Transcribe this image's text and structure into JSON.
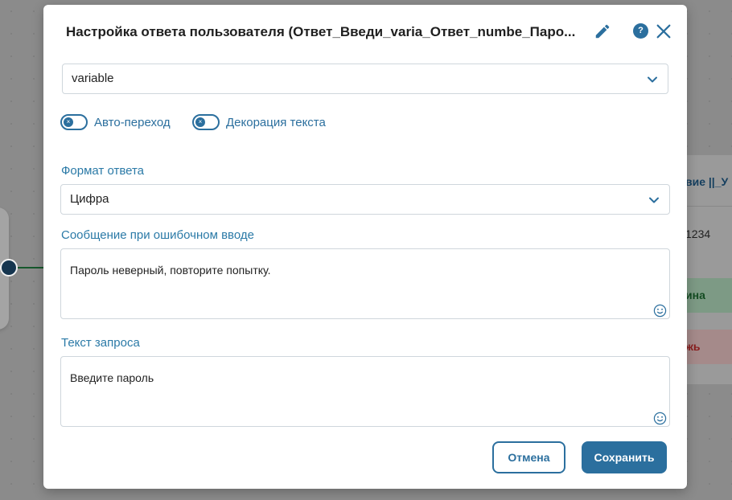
{
  "background": {
    "right_node": {
      "title": "вие ||_У",
      "value": "1234",
      "green_label": "ина",
      "red_label": "жь"
    }
  },
  "modal": {
    "title": "Настройка ответа пользователя (Ответ_Введи_varia_Ответ_numbe_Паро...",
    "icons": {
      "edit": "pencil-icon",
      "help": "?",
      "close": "close-icon"
    },
    "variable_select": {
      "value": "variable"
    },
    "toggles": [
      {
        "label": "Авто-переход",
        "on": false
      },
      {
        "label": "Декорация текста",
        "on": false
      }
    ],
    "format": {
      "label": "Формат ответа",
      "value": "Цифра"
    },
    "error_message": {
      "label": "Сообщение при ошибочном вводе",
      "value": "Пароль неверный, повторите попытку."
    },
    "prompt_text": {
      "label": "Текст запроса",
      "value": "Введите пароль"
    },
    "buttons": {
      "cancel": "Отмена",
      "save": "Сохранить"
    }
  },
  "colors": {
    "accent": "#2b6f9e",
    "label": "#2b7aa7",
    "overlay": "#8b8b8b"
  }
}
